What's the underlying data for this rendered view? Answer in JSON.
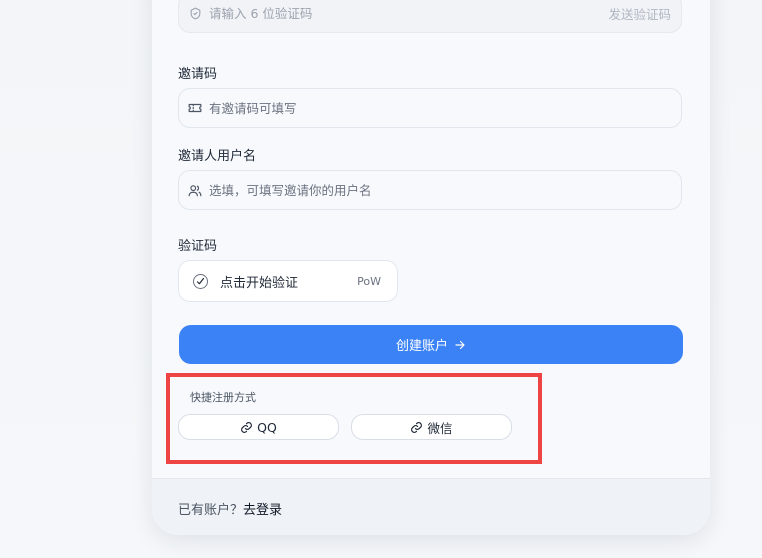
{
  "verify_code": {
    "placeholder": "请输入 6 位验证码",
    "send_label": "发送验证码",
    "icon": "shield-icon"
  },
  "invite_code": {
    "label": "邀请码",
    "placeholder": "有邀请码可填写",
    "icon": "ticket-icon"
  },
  "inviter": {
    "label": "邀请人用户名",
    "placeholder": "选填，可填写邀请你的用户名",
    "icon": "users-icon"
  },
  "captcha": {
    "label": "验证码",
    "text": "点击开始验证",
    "badge": "PoW"
  },
  "submit": {
    "label": "创建账户"
  },
  "quick_register": {
    "title": "快捷注册方式",
    "buttons": [
      {
        "label": "QQ",
        "icon": "link-icon"
      },
      {
        "label": "微信",
        "icon": "link-icon"
      }
    ]
  },
  "footer": {
    "prompt": "已有账户？",
    "login_link": "去登录"
  },
  "colors": {
    "primary": "#3b82f6",
    "highlight": "#ef4444"
  }
}
